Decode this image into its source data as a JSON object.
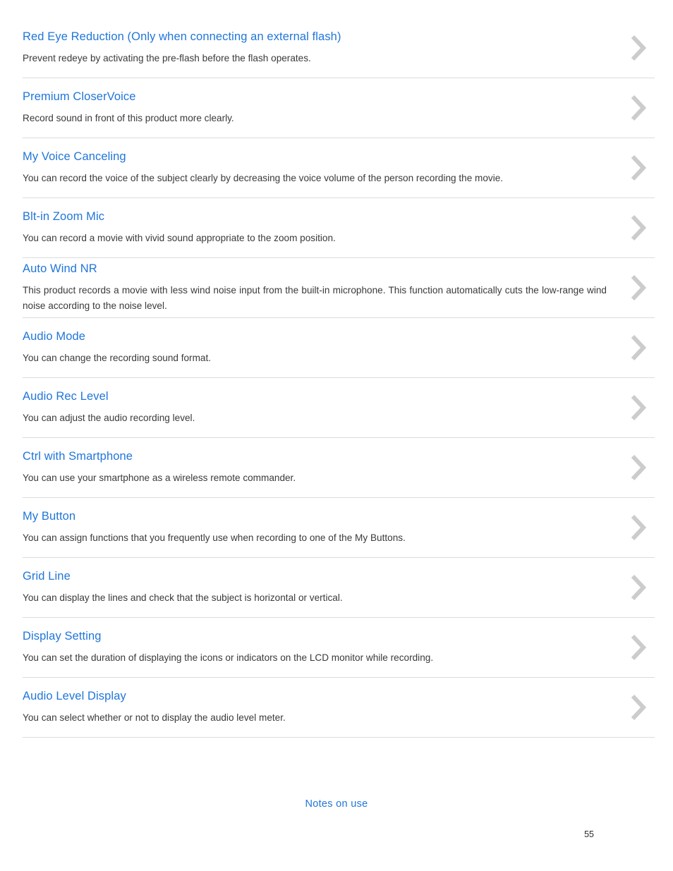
{
  "document": {
    "page_number": "55",
    "footer_link": "Notes on use",
    "link_color": "#2076d9",
    "text_color": "#3a3a3a",
    "divider_color": "#dcdcdc",
    "chevron_color": "#cccccc",
    "chevron_icon": "chevron-right-icon"
  },
  "entries": [
    {
      "title": "Red Eye Reduction (Only when connecting an external flash)",
      "description": "Prevent redeye by activating the pre-flash before the flash operates."
    },
    {
      "title": "Premium CloserVoice",
      "description": "Record sound in front of this product more clearly."
    },
    {
      "title": "My Voice Canceling",
      "description": "You can record the voice of the subject clearly by decreasing the voice volume of the person recording the movie."
    },
    {
      "title": "Blt-in Zoom Mic",
      "description": "You can record a movie with vivid sound appropriate to the zoom position."
    },
    {
      "title": "Auto Wind NR",
      "description": "This product records a movie with less wind noise input from the built-in microphone. This function automatically cuts the low-range wind noise according to the noise level."
    },
    {
      "title": "Audio Mode",
      "description": "You can change the recording sound format."
    },
    {
      "title": "Audio Rec Level",
      "description": "You can adjust the audio recording level."
    },
    {
      "title": "Ctrl with Smartphone",
      "description": "You can use your smartphone as a wireless remote commander."
    },
    {
      "title": "My Button",
      "description": "You can assign functions that you frequently use when recording to one of the My Buttons."
    },
    {
      "title": "Grid Line",
      "description": "You can display the lines and check that the subject is horizontal or vertical."
    },
    {
      "title": "Display Setting",
      "description": "You can set the duration of displaying the icons or indicators on the LCD monitor while recording."
    },
    {
      "title": "Audio Level Display",
      "description": "You can select whether or not to display the audio level meter."
    }
  ]
}
